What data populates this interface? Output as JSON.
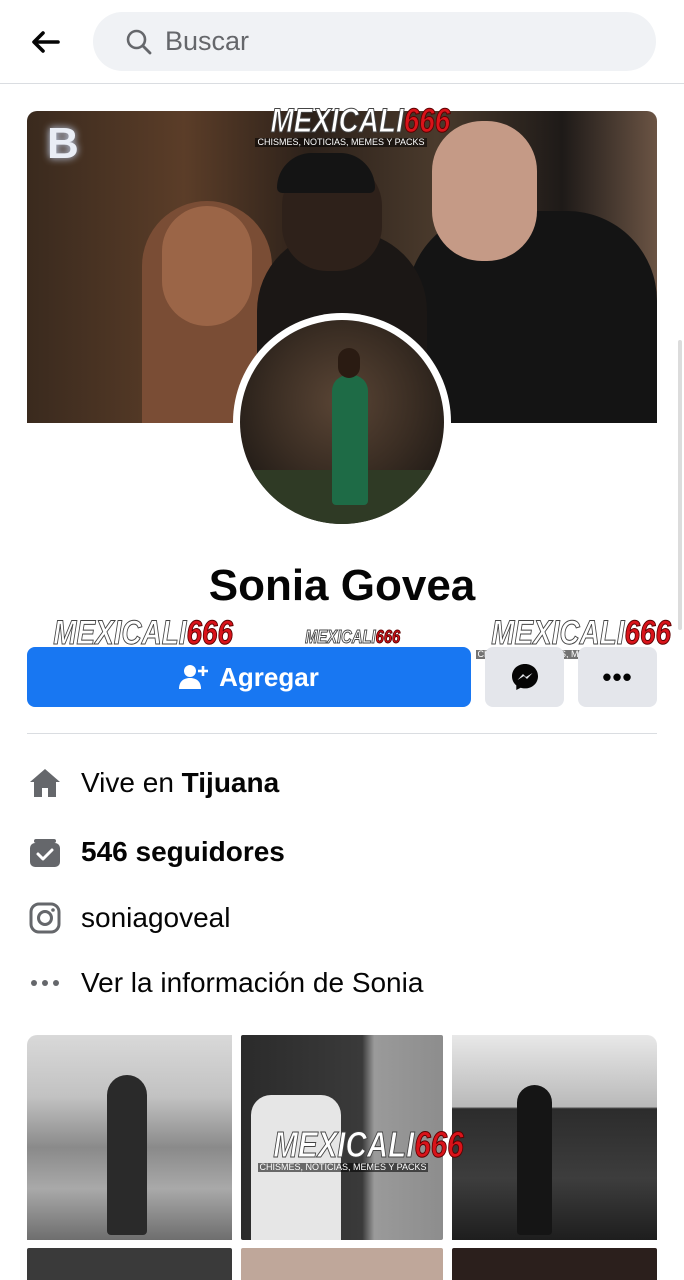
{
  "search": {
    "placeholder": "Buscar"
  },
  "profile": {
    "name": "Sonia Govea",
    "add_label": "Agregar",
    "more_label": "•••"
  },
  "cover": {
    "sign_text": "B"
  },
  "info": {
    "location_prefix": "Vive en ",
    "location_city": "Tijuana",
    "followers": "546 seguidores",
    "instagram": "soniagoveal",
    "see_info": "Ver la información de Sonia"
  },
  "watermark": {
    "part1": "MEXICALI",
    "part2": "666",
    "subtitle": "CHISMES, NOTICIAS, MEMES Y PACKS"
  },
  "colors": {
    "primary": "#1877f2",
    "secondary_button": "#e4e6eb",
    "search_bg": "#f0f2f5",
    "icon_gray": "#65676b",
    "text": "#050505"
  },
  "icons": {
    "back": "arrow-left-icon",
    "search": "search-icon",
    "add_friend": "add-friend-icon",
    "messenger": "messenger-icon",
    "home": "home-icon",
    "followers": "followers-icon",
    "instagram": "instagram-icon",
    "more_info": "dots-icon"
  }
}
